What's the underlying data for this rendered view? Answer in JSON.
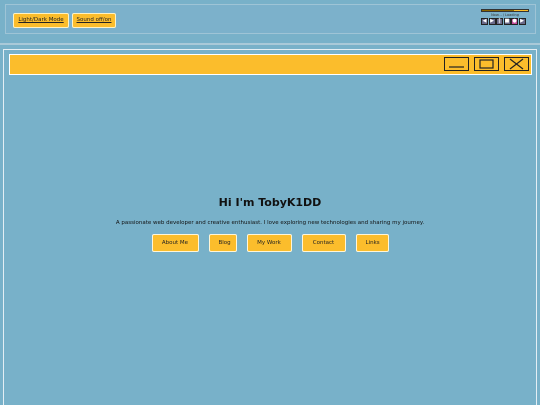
{
  "toolbar": {
    "theme_toggle_label": "Light/Dark Mode",
    "sound_toggle_label": "Sound off/on"
  },
  "player": {
    "track_label": "Now... / Loading",
    "progress_fraction": 0.7,
    "controls": [
      "prev",
      "play",
      "pause",
      "stop",
      "next",
      "alt"
    ]
  },
  "window": {
    "controls": [
      "minimize",
      "maximize",
      "close"
    ]
  },
  "hero": {
    "title": "Hi I'm TobyK1DD",
    "subtitle": "A passionate web developer and creative enthusiast. I love exploring new technologies and sharing my journey."
  },
  "nav": {
    "items": [
      "About Me",
      "Blog",
      "My Work",
      "Contact",
      "Links"
    ]
  },
  "colors": {
    "background": "#78b1c9",
    "accent": "#fbbd2c"
  }
}
